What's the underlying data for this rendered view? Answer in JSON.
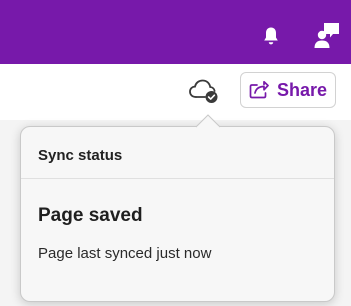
{
  "header": {
    "background_color": "#7719aa",
    "icons": [
      "bell-icon",
      "feedback-icon"
    ]
  },
  "toolbar": {
    "sync_icon": "cloud-check-icon",
    "share_label": "Share",
    "share_icon": "share-arrow-icon",
    "accent_color": "#7719aa"
  },
  "sync_popover": {
    "title": "Sync status",
    "status": "Page saved",
    "detail": "Page last synced just now"
  }
}
